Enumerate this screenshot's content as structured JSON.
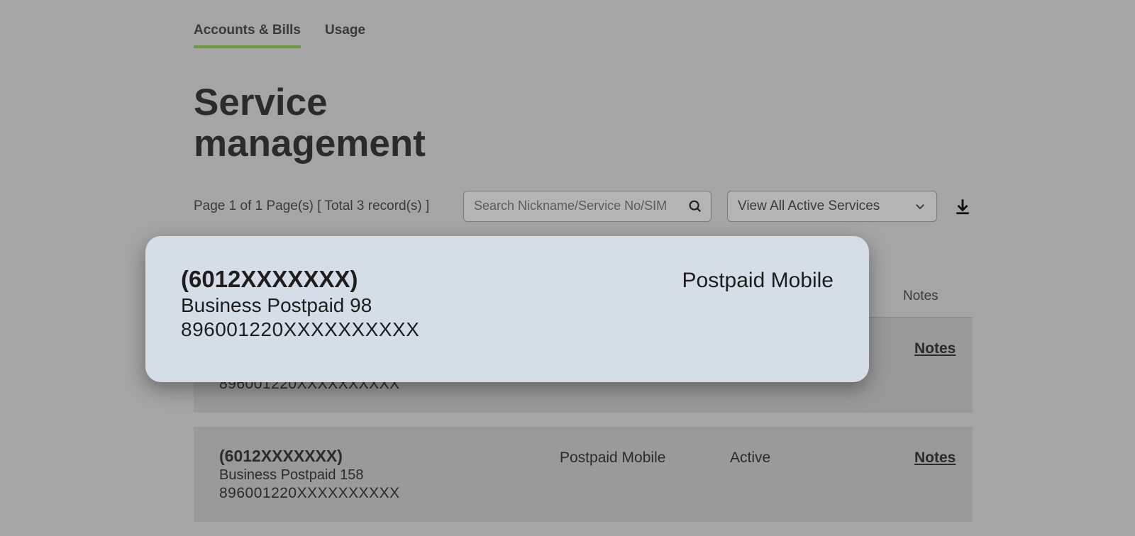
{
  "tabs": {
    "accounts": "Accounts & Bills",
    "usage": "Usage"
  },
  "page_title_line1": "Service",
  "page_title_line2": "management",
  "pagination_text": "Page 1 of 1 Page(s)  [ Total 3 record(s) ]",
  "search": {
    "placeholder": "Search Nickname/Service No/SIM"
  },
  "filter": {
    "selected": "View All Active Services"
  },
  "table": {
    "headers": {
      "notes": "Notes"
    },
    "rows": [
      {
        "service_no": "(6012XXXXXXX)",
        "plan": "Business Postpaid 98",
        "sim": "896001220XXXXXXXXXX",
        "type": "Postpaid Mobile",
        "status": "",
        "notes_label": "Notes"
      },
      {
        "service_no": "(6012XXXXXXX)",
        "plan": "Business Postpaid 158",
        "sim": "896001220XXXXXXXXXX",
        "type": "Postpaid Mobile",
        "status": "Active",
        "notes_label": "Notes"
      }
    ]
  },
  "highlight": {
    "service_no": "(6012XXXXXXX)",
    "plan": "Business Postpaid 98",
    "sim": "896001220XXXXXXXXXX",
    "type": "Postpaid Mobile"
  }
}
